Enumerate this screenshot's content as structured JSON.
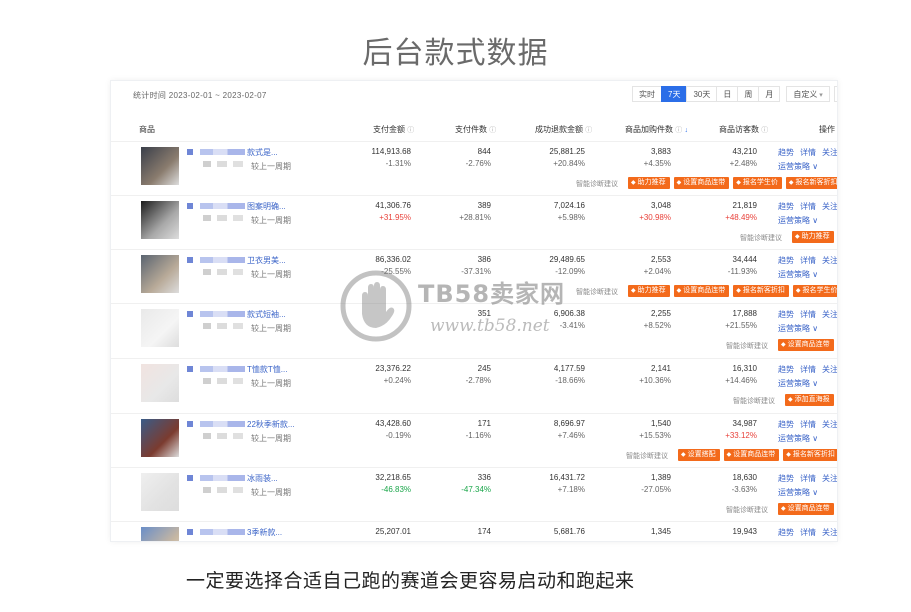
{
  "slide": {
    "title": "后台款式数据",
    "caption": "一定要选择合适自己跑的赛道会更容易启动和跑起来"
  },
  "watermark": {
    "text": "TB58卖家网",
    "url": "www.tb58.net"
  },
  "toolbar": {
    "period_label": "统计时间 2023-02-01 ~ 2023-02-07",
    "tabs": [
      "实时",
      "7天",
      "30天",
      "日",
      "周",
      "月"
    ],
    "active_tab": "7天",
    "custom_label": "自定义",
    "prev_icon": "chevron-left-icon",
    "next_icon": "chevron-right-icon"
  },
  "table": {
    "headers": {
      "product": "商品",
      "pay_amount": "支付金额",
      "pay_count": "支付件数",
      "refund_amount": "成功退款金额",
      "cart_count": "商品加购件数",
      "visitors": "商品访客数",
      "action": "操作"
    },
    "compare_label": "较上一周期",
    "advice_label": "智能诊断建议",
    "op_labels": {
      "trend": "趋势",
      "detail": "详情",
      "follow": "关注",
      "strategy": "运营策略 ∨"
    },
    "rows": [
      {
        "name": "款式是...",
        "pay_amount": "114,913.68",
        "pay_amount_chg": "-1.31%",
        "pay_count": "844",
        "pay_count_chg": "-2.76%",
        "refund": "25,881.25",
        "refund_chg": "+20.84%",
        "cart": "3,883",
        "cart_chg": "+4.35%",
        "visitors": "43,210",
        "visitors_chg": "+2.48%",
        "tags": [
          "助力推荐",
          "设置商品连带",
          "报名学生价",
          "报名新客折扣"
        ]
      },
      {
        "name": "图案明确...",
        "pay_amount": "41,306.76",
        "pay_amount_chg": "+31.95%",
        "pay_count": "389",
        "pay_count_chg": "+28.81%",
        "refund": "7,024.16",
        "refund_chg": "+5.98%",
        "cart": "3,048",
        "cart_chg": "+30.98%",
        "visitors": "21,819",
        "visitors_chg": "+48.49%",
        "tags": [
          "助力推荐"
        ]
      },
      {
        "name": "卫衣男美...",
        "pay_amount": "86,336.02",
        "pay_amount_chg": "-25.55%",
        "pay_count": "386",
        "pay_count_chg": "-37.31%",
        "refund": "29,489.65",
        "refund_chg": "-12.09%",
        "cart": "2,553",
        "cart_chg": "+2.04%",
        "visitors": "34,444",
        "visitors_chg": "-11.93%",
        "tags": [
          "助力推荐",
          "设置商品连带",
          "报名新客折扣",
          "报名学生价"
        ]
      },
      {
        "name": "款式短袖...",
        "pay_amount": "",
        "pay_amount_chg": "",
        "pay_count": "351",
        "pay_count_chg": "",
        "refund": "6,906.38",
        "refund_chg": "-3.41%",
        "cart": "2,255",
        "cart_chg": "+8.52%",
        "visitors": "17,888",
        "visitors_chg": "+21.55%",
        "tags": [
          "设置商品连带"
        ]
      },
      {
        "name": "T恤款T恤...",
        "pay_amount": "23,376.22",
        "pay_amount_chg": "+0.24%",
        "pay_count": "245",
        "pay_count_chg": "-2.78%",
        "refund": "4,177.59",
        "refund_chg": "-18.66%",
        "cart": "2,141",
        "cart_chg": "+10.36%",
        "visitors": "16,310",
        "visitors_chg": "+14.46%",
        "tags": [
          "添加直海报"
        ]
      },
      {
        "name": "22秋季新款...",
        "pay_amount": "43,428.60",
        "pay_amount_chg": "-0.19%",
        "pay_count": "171",
        "pay_count_chg": "-1.16%",
        "refund": "8,696.97",
        "refund_chg": "+7.46%",
        "cart": "1,540",
        "cart_chg": "+15.53%",
        "visitors": "34,987",
        "visitors_chg": "+33.12%",
        "tags": [
          "设置搭配",
          "设置商品连带",
          "报名新客折扣"
        ]
      },
      {
        "name": "冰雨装...",
        "pay_amount": "32,218.65",
        "pay_amount_chg": "-46.83%",
        "pay_count": "336",
        "pay_count_chg": "-47.34%",
        "refund": "16,431.72",
        "refund_chg": "+7.18%",
        "cart": "1,389",
        "cart_chg": "-27.05%",
        "visitors": "18,630",
        "visitors_chg": "-3.63%",
        "tags": [
          "设置商品连带"
        ]
      },
      {
        "name": "3季新款...",
        "pay_amount": "25,207.01",
        "pay_amount_chg": "",
        "pay_count": "174",
        "pay_count_chg": "",
        "refund": "5,681.76",
        "refund_chg": "",
        "cart": "1,345",
        "cart_chg": "",
        "visitors": "19,943",
        "visitors_chg": "",
        "tags": []
      }
    ]
  },
  "colors": {
    "accent": "#2b6ee8",
    "tag_orange": "#f36a1b",
    "increase_red": "#e8423b",
    "decrease_green": "#1aa64a",
    "link_blue": "#3b64c8"
  }
}
